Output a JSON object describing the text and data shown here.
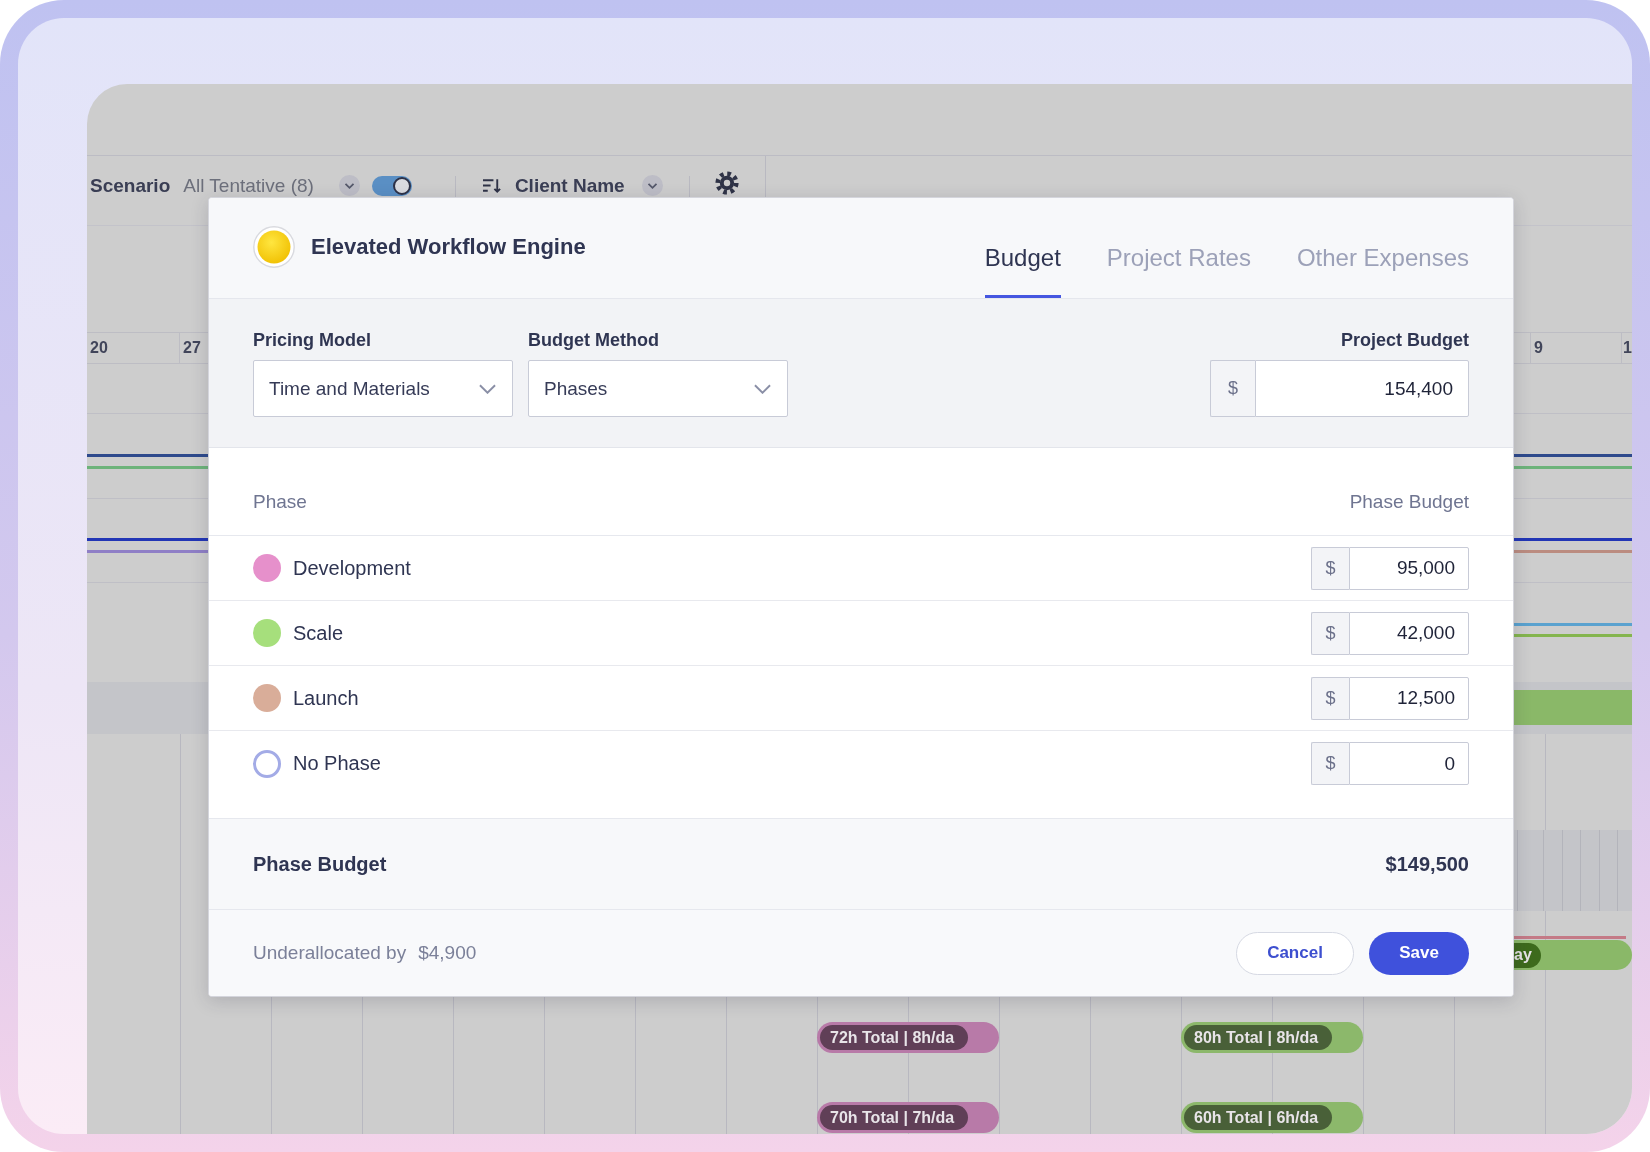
{
  "scheduler": {
    "toolbar": {
      "scenario": {
        "label": "Scenario",
        "value": "All Tentative (8)",
        "toggle_on": true
      },
      "sort": {
        "label": "Client Name"
      }
    },
    "dates": [
      "20",
      "27",
      "9",
      "1"
    ],
    "edge_bar": {
      "label": "ay"
    },
    "bar_rows": [
      {
        "bars": [
          {
            "label": "72h Total | 8h/da",
            "color": "#b87aa8"
          },
          {
            "label": "80h Total | 8h/da",
            "color": "#8cb86b"
          }
        ]
      },
      {
        "bars": [
          {
            "label": "70h Total | 7h/da",
            "color": "#b87aa8"
          },
          {
            "label": "60h Total | 6h/da",
            "color": "#8cb86b"
          }
        ]
      }
    ]
  },
  "modal": {
    "project": {
      "name": "Elevated Workflow Engine"
    },
    "tabs": [
      {
        "label": "Budget",
        "selected": true
      },
      {
        "label": "Project Rates",
        "selected": false
      },
      {
        "label": "Other Expenses",
        "selected": false
      }
    ],
    "pricing_model": {
      "label": "Pricing Model",
      "value": "Time and Materials"
    },
    "budget_method": {
      "label": "Budget Method",
      "value": "Phases"
    },
    "project_budget": {
      "label": "Project Budget",
      "currency": "$",
      "value": "154,400"
    },
    "phase_table": {
      "columns": [
        "Phase",
        "Phase Budget"
      ],
      "rows": [
        {
          "name": "Development",
          "kind": "filled",
          "color": "#e690cb",
          "currency": "$",
          "value": "95,000"
        },
        {
          "name": "Scale",
          "kind": "filled",
          "color": "#a6df7c",
          "currency": "$",
          "value": "42,000"
        },
        {
          "name": "Launch",
          "kind": "filled",
          "color": "#d9ad99",
          "currency": "$",
          "value": "12,500"
        },
        {
          "name": "No Phase",
          "kind": "outline",
          "color": "#a3abe6",
          "currency": "$",
          "value": "0"
        }
      ]
    },
    "total": {
      "label": "Phase Budget",
      "value": "$149,500"
    },
    "footer": {
      "status_label": "Underallocated by",
      "status_value": "$4,900",
      "buttons": [
        {
          "label": "Cancel",
          "kind": "secondary"
        },
        {
          "label": "Save",
          "kind": "primary"
        }
      ]
    }
  }
}
